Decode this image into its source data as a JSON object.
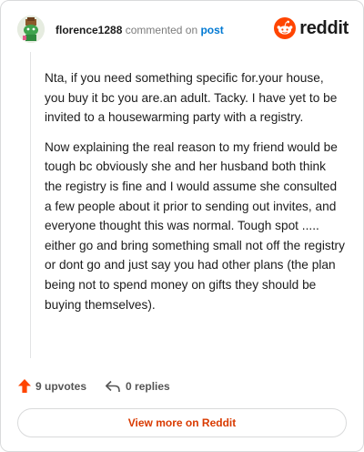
{
  "header": {
    "username": "florence1288",
    "action_text": "commented on",
    "post_link": "post",
    "brand": "reddit"
  },
  "comment": {
    "paragraphs": [
      "Nta, if you need something specific for.your house, you buy it bc you are.an adult. Tacky. I have yet to be invited to a housewarming party with a registry.",
      "Now explaining the real reason to my friend would be tough bc obviously she and her husband both think the registry is fine and I would assume she consulted a few people about it prior to sending out invites, and everyone thought this was normal. Tough spot ..... either go and bring something small not off the registry or dont go and just say you had other plans (the plan being not to spend money on gifts they should be buying themselves)."
    ]
  },
  "actions": {
    "upvotes": "9 upvotes",
    "replies": "0 replies"
  },
  "footer": {
    "view_more": "View more on Reddit"
  },
  "colors": {
    "reddit_orange": "#ff4500",
    "link_blue": "#0079d3",
    "cta_text": "#d93a00"
  },
  "icons": {
    "avatar": "snoo-avatar",
    "brand": "reddit-logo-icon",
    "upvote": "upvote-arrow-icon",
    "reply": "reply-arrow-icon"
  }
}
